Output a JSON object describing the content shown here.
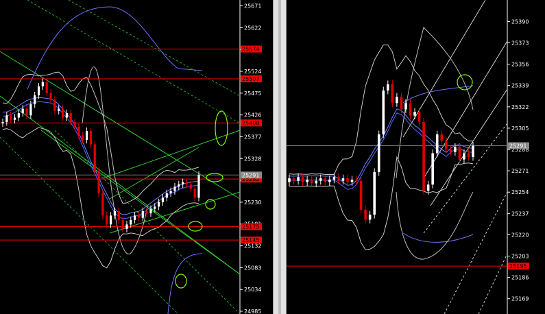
{
  "chart_data": [
    {
      "type": "candlestick",
      "name": "left-panel",
      "y_axis_ticks": [
        25671,
        25622,
        25573,
        25524,
        25475,
        25426,
        25377,
        25328,
        25279,
        25230,
        25181,
        25132,
        25083,
        25034,
        24985
      ],
      "ylim": [
        24985,
        25678
      ],
      "horizontal_levels": [
        {
          "label": "25574",
          "value": 25574
        },
        {
          "label": "25507",
          "value": 25507
        },
        {
          "label": "25408",
          "value": 25408
        },
        {
          "label": "25282",
          "value": 25282
        },
        {
          "label": "25175",
          "value": 25175
        },
        {
          "label": "25145",
          "value": 25145
        }
      ],
      "current_price_label": "25291",
      "current_price": 25291,
      "up_color": "#ffffff",
      "down_color": "#e00000",
      "level_color": "#ff0000",
      "closes": [
        25410,
        25425,
        25415,
        25420,
        25430,
        25440,
        25425,
        25450,
        25470,
        25490,
        25500,
        25475,
        25460,
        25435,
        25440,
        25420,
        25430,
        25410,
        25400,
        25380,
        25370,
        25390,
        25360,
        25300,
        25250,
        25200,
        25180,
        25200,
        25210,
        25190,
        25170,
        25180,
        25190,
        25200,
        25195,
        25210,
        25205,
        25215,
        25220,
        25230,
        25240,
        25250,
        25255,
        25265,
        25270,
        25275,
        25270,
        25260,
        25240,
        25291
      ]
    },
    {
      "type": "candlestick",
      "name": "right-panel",
      "y_axis_ticks": [
        25390,
        25373,
        25356,
        25339,
        25322,
        25305,
        25288,
        25271,
        25254,
        25237,
        25220,
        25203,
        25186,
        25169
      ],
      "ylim": [
        25159,
        25405
      ],
      "horizontal_levels": [
        {
          "label": "25195",
          "value": 25195
        }
      ],
      "current_price_label": "25291",
      "current_price": 25291,
      "up_color": "#ffffff",
      "down_color": "#e00000",
      "level_color": "#ff0000",
      "closes": [
        25265,
        25263,
        25266,
        25262,
        25264,
        25261,
        25263,
        25265,
        25262,
        25264,
        25266,
        25263,
        25265,
        25262,
        25264,
        25263,
        25240,
        25232,
        25236,
        25270,
        25300,
        25335,
        25340,
        25325,
        25330,
        25320,
        25325,
        25315,
        25318,
        25310,
        25255,
        25260,
        25285,
        25300,
        25295,
        25288,
        25286,
        25290,
        25280,
        25285,
        25282,
        25291
      ]
    }
  ]
}
